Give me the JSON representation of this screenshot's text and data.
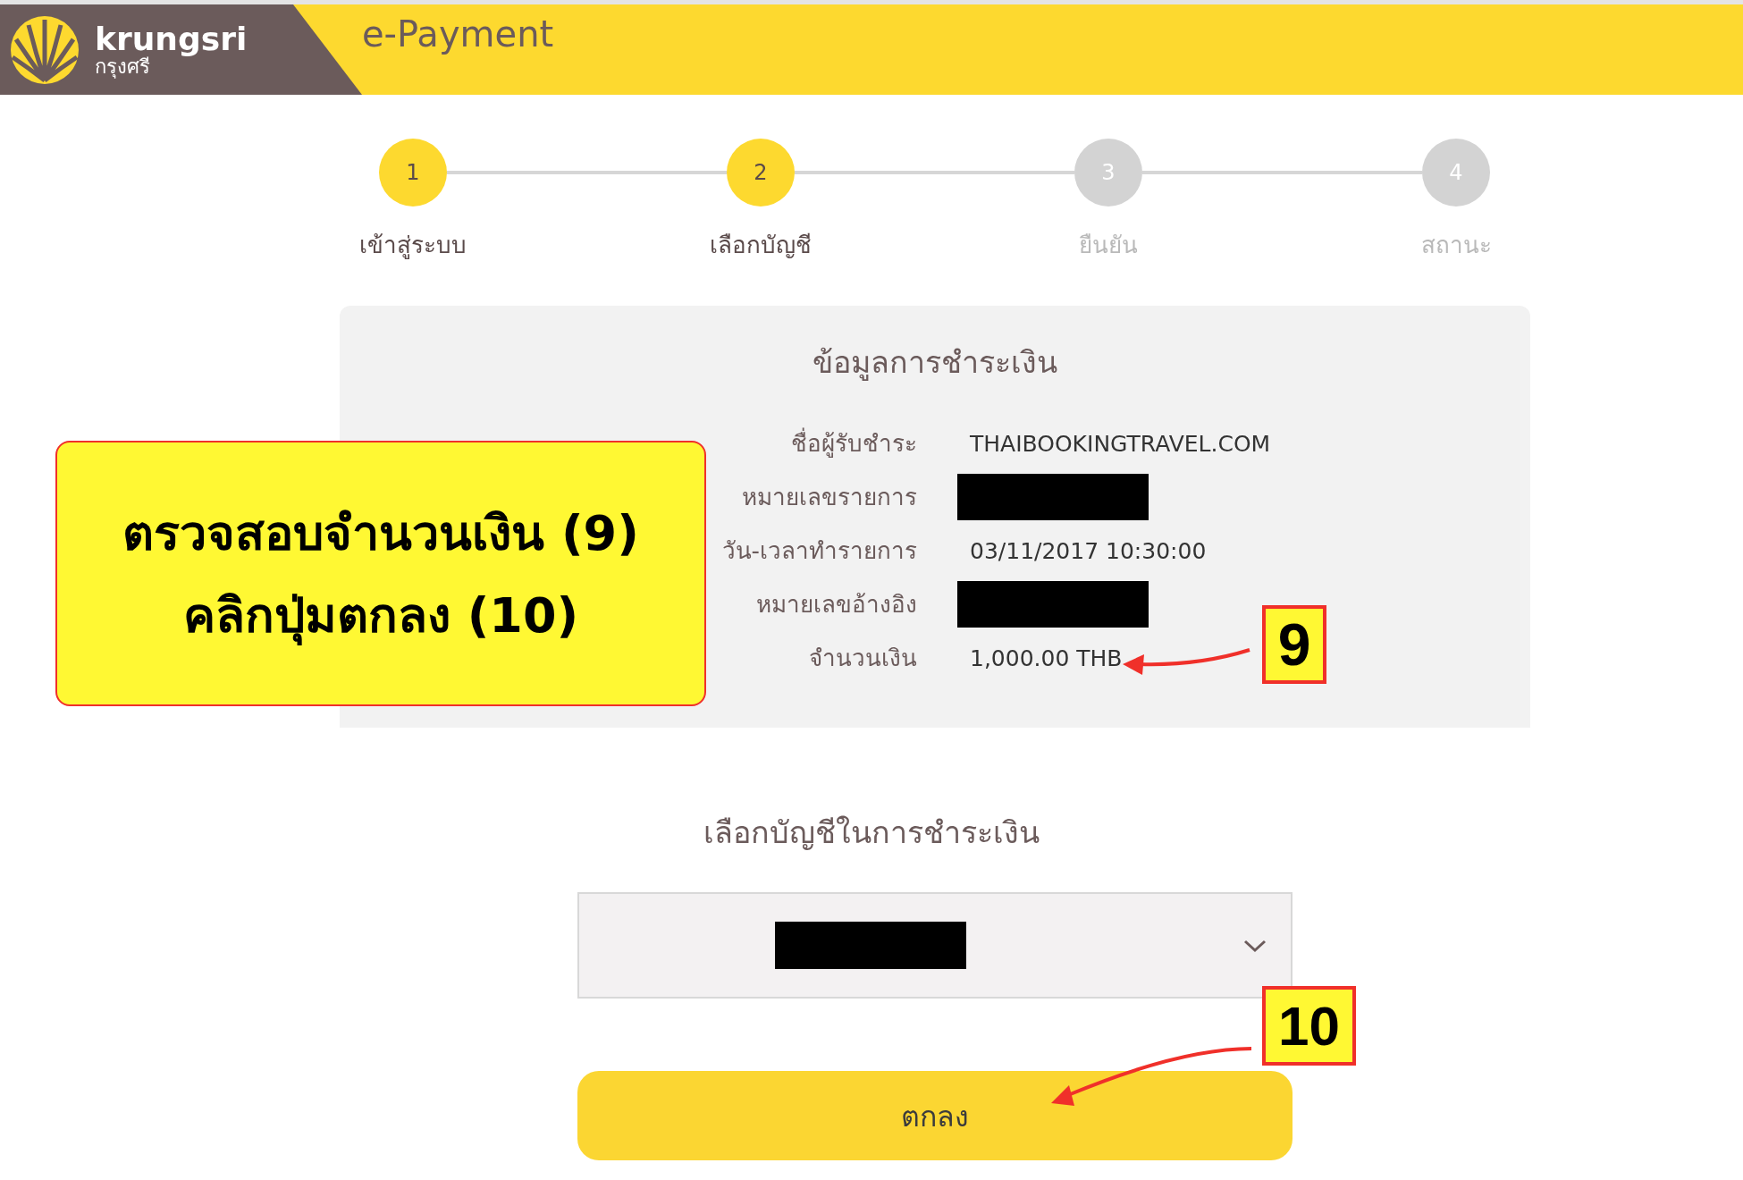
{
  "header": {
    "logo_text": "krungsri",
    "logo_subtext": "กรุงศรี",
    "title": "e-Payment"
  },
  "steps": [
    {
      "number": "1",
      "label": "เข้าสู่ระบบ",
      "completed": true
    },
    {
      "number": "2",
      "label": "เลือกบัญชี",
      "completed": true
    },
    {
      "number": "3",
      "label": "ยืนยัน",
      "completed": false
    },
    {
      "number": "4",
      "label": "สถานะ",
      "completed": false
    }
  ],
  "payment_info": {
    "title": "ข้อมูลการชำระเงิน",
    "rows": [
      {
        "label": "ชื่อผู้รับชำระ",
        "kind": "text",
        "value": "THAIBOOKINGTRAVEL.COM"
      },
      {
        "label": "หมายเลขรายการ",
        "kind": "redacted"
      },
      {
        "label": "วัน-เวลาทำรายการ",
        "kind": "text",
        "value": "03/11/2017 10:30:00"
      },
      {
        "label": "หมายเลขอ้างอิง",
        "kind": "redacted"
      },
      {
        "label": "จำนวนเงิน",
        "kind": "text",
        "value": "1,000.00 THB"
      }
    ]
  },
  "account_select": {
    "title": "เลือกบัญชีในการชำระเงิน",
    "value_redacted": true
  },
  "confirm_button": {
    "label": "ตกลง"
  },
  "annotations": {
    "callout": [
      "ตรวจสอบจำนวนเงิน (9)",
      "คลิกปุ่มตกลง (10)"
    ],
    "markers": [
      "9",
      "10"
    ]
  }
}
